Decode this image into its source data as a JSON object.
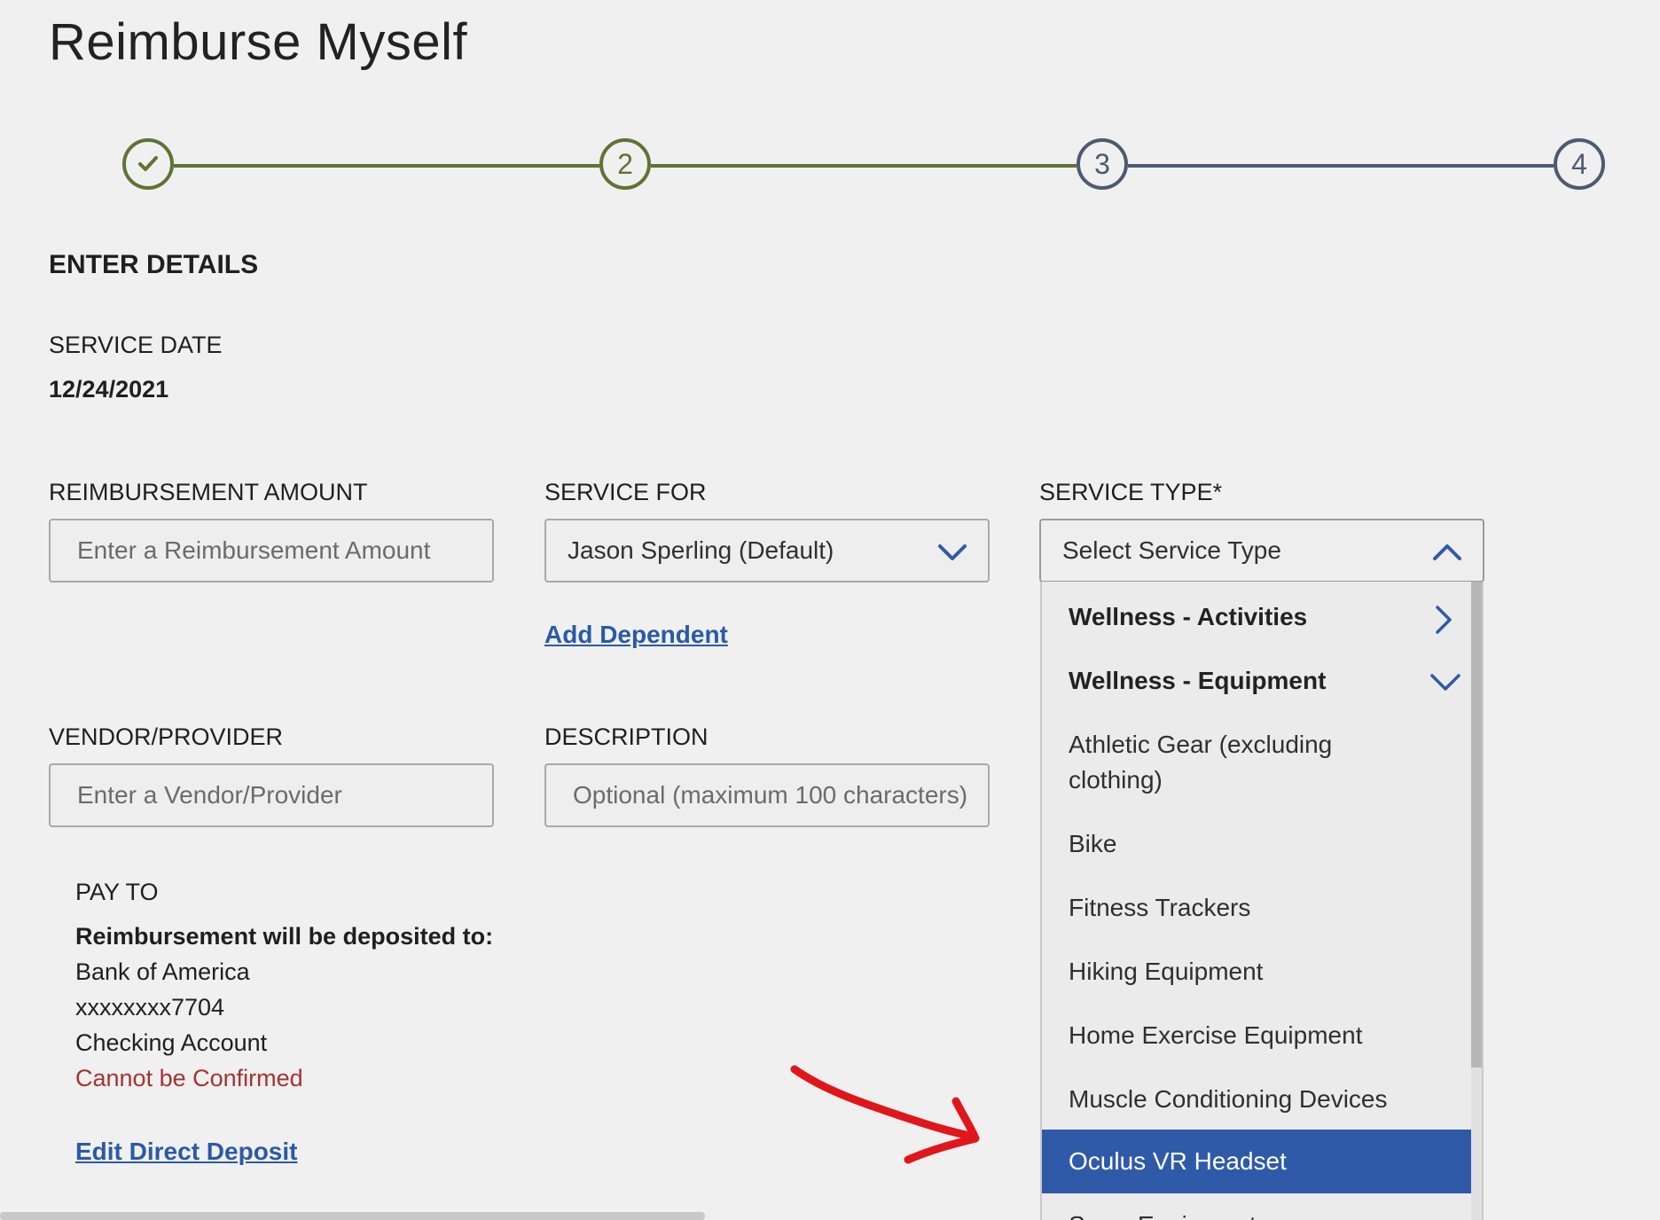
{
  "page": {
    "title": "Reimburse Myself"
  },
  "stepper": {
    "steps": [
      {
        "label": "",
        "state": "complete"
      },
      {
        "label": "2",
        "state": "active"
      },
      {
        "label": "3",
        "state": "upcoming"
      },
      {
        "label": "4",
        "state": "upcoming"
      }
    ]
  },
  "section": {
    "heading": "ENTER DETAILS"
  },
  "service_date": {
    "label": "SERVICE DATE",
    "value": "12/24/2021"
  },
  "reimbursement_amount": {
    "label": "REIMBURSEMENT AMOUNT",
    "placeholder": "Enter a Reimbursement Amount"
  },
  "service_for": {
    "label": "SERVICE FOR",
    "value": "Jason Sperling (Default)",
    "add_dependent": "Add Dependent"
  },
  "service_type": {
    "label": "SERVICE TYPE*",
    "value": "Select Service Type",
    "options": [
      {
        "label": "Wellness - Activities",
        "group": true,
        "expanded": false
      },
      {
        "label": "Wellness - Equipment",
        "group": true,
        "expanded": true
      },
      {
        "label": "Athletic Gear (excluding clothing)"
      },
      {
        "label": "Bike"
      },
      {
        "label": "Fitness Trackers"
      },
      {
        "label": "Hiking Equipment"
      },
      {
        "label": "Home Exercise Equipment"
      },
      {
        "label": "Muscle Conditioning Devices"
      },
      {
        "label": "Oculus VR Headset",
        "selected": true
      },
      {
        "label": "Snow Equipment"
      }
    ]
  },
  "vendor": {
    "label": "VENDOR/PROVIDER",
    "placeholder": "Enter a Vendor/Provider"
  },
  "description": {
    "label": "DESCRIPTION",
    "placeholder": "Optional (maximum 100 characters)"
  },
  "pay_to": {
    "label": "PAY TO",
    "deposit_heading": "Reimbursement will be deposited to:",
    "bank": "Bank of America",
    "account_number": "xxxxxxxx7704",
    "account_type": "Checking Account",
    "status": "Cannot be Confirmed",
    "edit_link": "Edit Direct Deposit"
  },
  "colors": {
    "complete": "#5f7335",
    "upcoming": "#4d5b70",
    "link": "#2a5aa6",
    "selected_option": "#2f5aa8",
    "error": "#a83232",
    "annotation_arrow": "#e0161b"
  },
  "icons": {
    "step_complete": "checkmark-icon",
    "select_closed": "chevron-down-icon",
    "select_open": "chevron-up-icon",
    "group_collapsed": "chevron-right-icon",
    "group_expanded": "chevron-down-icon"
  }
}
